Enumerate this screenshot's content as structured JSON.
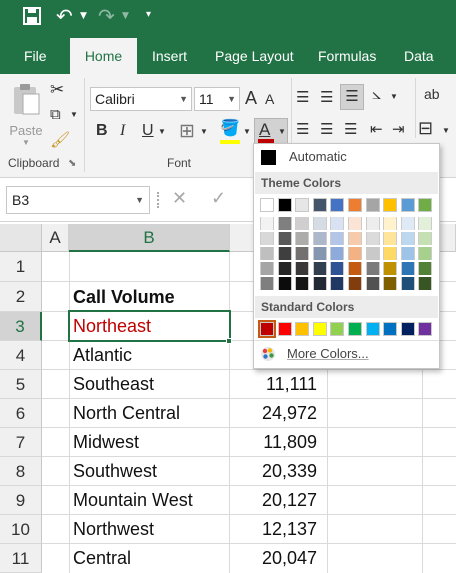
{
  "qat": {
    "save_icon": "save-icon",
    "undo_icon": "undo-icon",
    "redo_icon": "redo-icon",
    "customize_icon": "customize-qat-icon"
  },
  "tabs": [
    "File",
    "Home",
    "Insert",
    "Page Layout",
    "Formulas",
    "Data"
  ],
  "ribbon": {
    "paste_label": "Paste",
    "clipboard_label": "Clipboard",
    "font_label": "Font",
    "font_name": "Calibri",
    "font_size": "11",
    "bold": "B",
    "italic": "I",
    "underline": "U",
    "grow": "A",
    "shrink": "A",
    "font_color_glyph": "A",
    "wrap_glyph": "ab"
  },
  "formula_bar": {
    "name_box": "B3"
  },
  "columns": [
    "A",
    "B"
  ],
  "rows": [
    {
      "num": "1",
      "b": "",
      "c": ""
    },
    {
      "num": "2",
      "b": "Call Volume",
      "c": ""
    },
    {
      "num": "3",
      "b": "Northeast",
      "c": ""
    },
    {
      "num": "4",
      "b": "Atlantic",
      "c": ""
    },
    {
      "num": "5",
      "b": "Southeast",
      "c": "11,111"
    },
    {
      "num": "6",
      "b": "North Central",
      "c": "24,972"
    },
    {
      "num": "7",
      "b": "Midwest",
      "c": "11,809"
    },
    {
      "num": "8",
      "b": "Southwest",
      "c": "20,339"
    },
    {
      "num": "9",
      "b": "Mountain West",
      "c": "20,127"
    },
    {
      "num": "10",
      "b": "Northwest",
      "c": "12,137"
    },
    {
      "num": "11",
      "b": "Central",
      "c": "20,047"
    }
  ],
  "colors": {
    "accent": "#217346",
    "selected_text": "#c00000",
    "font_color_bar": "#c00000"
  },
  "dropdown": {
    "automatic": "Automatic",
    "theme_header": "Theme Colors",
    "standard_header": "Standard Colors",
    "more_colors": "More Colors...",
    "theme_base": [
      "#ffffff",
      "#000000",
      "#e7e6e6",
      "#44546a",
      "#4472c4",
      "#ed7d31",
      "#a5a5a5",
      "#ffc000",
      "#5b9bd5",
      "#70ad47"
    ],
    "theme_tints": [
      [
        "#f2f2f2",
        "#7f7f7f",
        "#d0cece",
        "#d6dce4",
        "#d9e2f3",
        "#fbe4d5",
        "#ededed",
        "#fff2cc",
        "#deebf6",
        "#e2efd9"
      ],
      [
        "#d8d8d8",
        "#595959",
        "#aeabab",
        "#adb9ca",
        "#b4c6e7",
        "#f7caac",
        "#dbdbdb",
        "#fee599",
        "#bdd7ee",
        "#c5e0b3"
      ],
      [
        "#bfbfbf",
        "#3f3f3f",
        "#757070",
        "#8496b0",
        "#8eaadb",
        "#f4b183",
        "#c9c9c9",
        "#ffd965",
        "#9dc3e6",
        "#a8d08d"
      ],
      [
        "#a5a5a5",
        "#262626",
        "#3a3838",
        "#323f4f",
        "#2f5496",
        "#c55a11",
        "#7b7b7b",
        "#bf9000",
        "#2e75b5",
        "#538135"
      ],
      [
        "#7f7f7f",
        "#0c0c0c",
        "#171616",
        "#222a35",
        "#1f3864",
        "#833c0b",
        "#525252",
        "#7f6000",
        "#1f4e79",
        "#375623"
      ]
    ],
    "standard": [
      "#c00000",
      "#ff0000",
      "#ffc000",
      "#ffff00",
      "#92d050",
      "#00b050",
      "#00b0f0",
      "#0070c0",
      "#002060",
      "#7030a0"
    ]
  }
}
